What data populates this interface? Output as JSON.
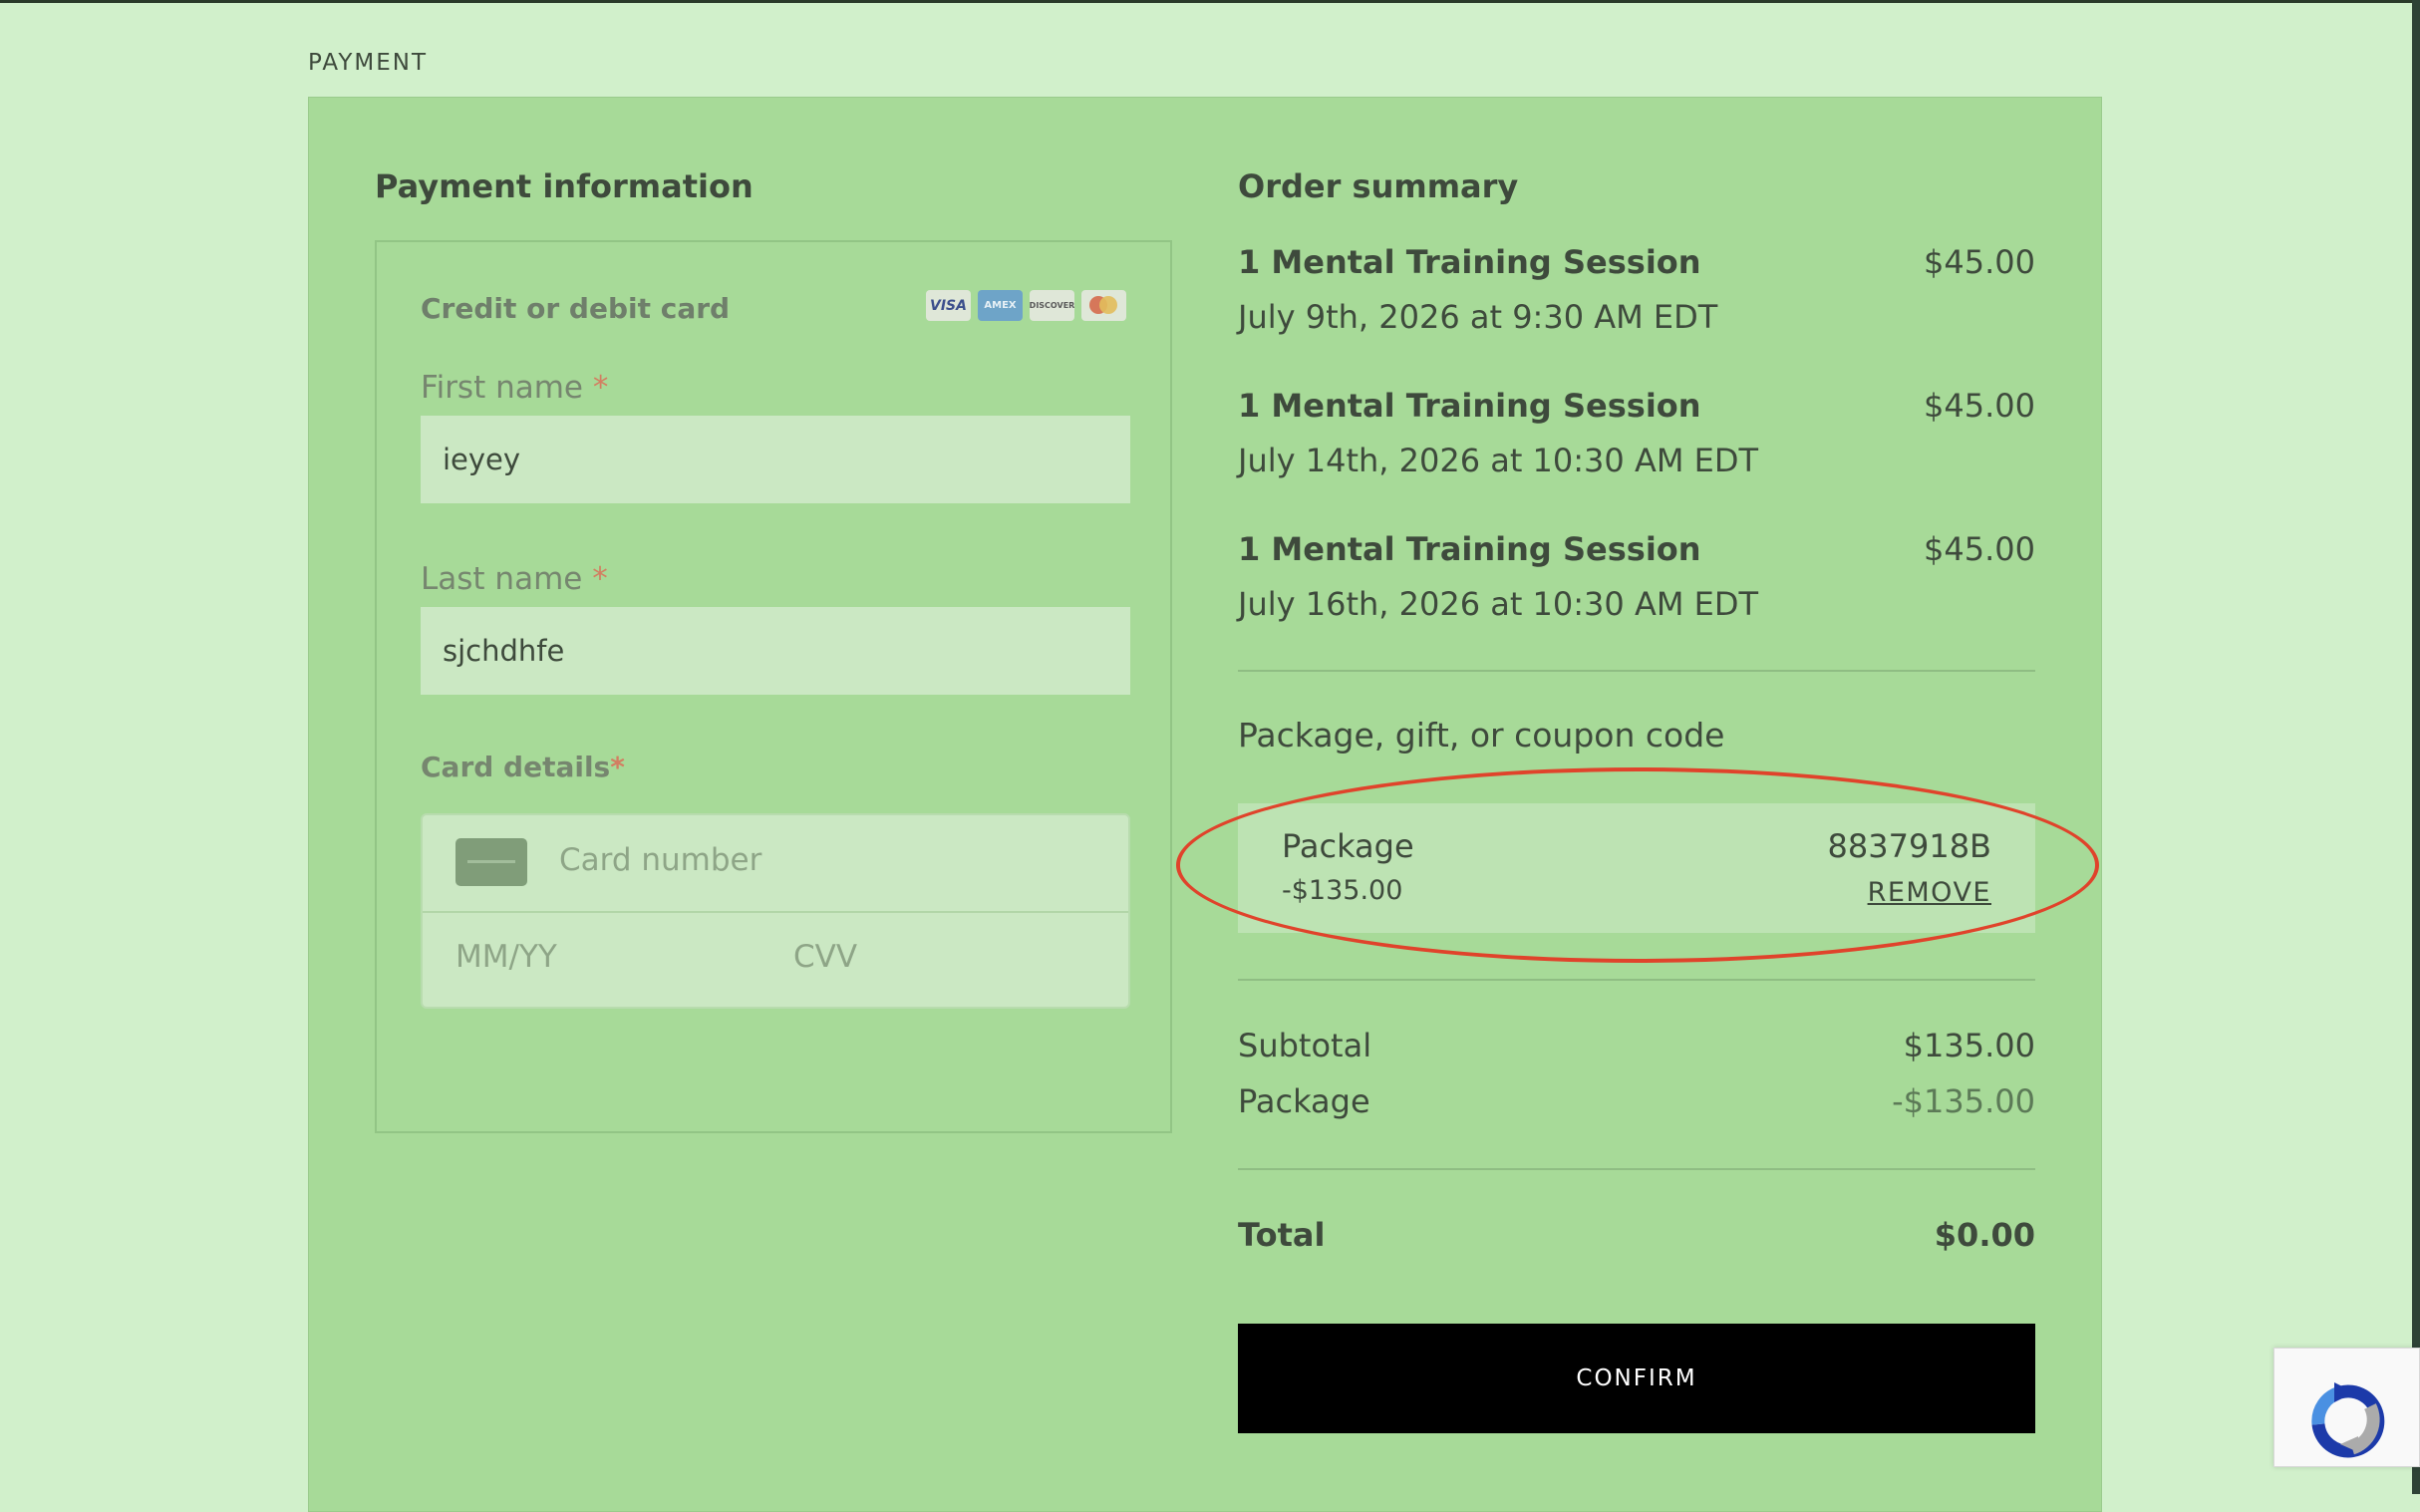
{
  "page": {
    "section_heading": "PAYMENT"
  },
  "payment": {
    "title": "Payment information",
    "card_type_label": "Credit or debit card",
    "brands": [
      "VISA",
      "AMEX",
      "DISCOVER",
      "mastercard"
    ],
    "first_name_label": "First name",
    "first_name_value": "ieyey",
    "last_name_label": "Last name",
    "last_name_value": "sjchdhfe",
    "required_mark": "*",
    "card_details_label": "Card details",
    "card_number_placeholder": "Card number",
    "expiry_placeholder": "MM/YY",
    "cvv_placeholder": "CVV"
  },
  "order": {
    "title": "Order summary",
    "items": [
      {
        "name": "1 Mental Training Session",
        "price": "$45.00",
        "date": "July 9th, 2026 at 9:30 AM EDT"
      },
      {
        "name": "1 Mental Training Session",
        "price": "$45.00",
        "date": "July 14th, 2026 at 10:30 AM EDT"
      },
      {
        "name": "1 Mental Training Session",
        "price": "$45.00",
        "date": "July 16th, 2026 at 10:30 AM EDT"
      }
    ],
    "coupon_label": "Package, gift, or coupon code",
    "package": {
      "name": "Package",
      "amount": "-$135.00",
      "code": "8837918B",
      "remove_label": "REMOVE"
    },
    "subtotal_label": "Subtotal",
    "subtotal_value": "$135.00",
    "package_label": "Package",
    "package_value": "-$135.00",
    "total_label": "Total",
    "total_value": "$0.00",
    "confirm_label": "CONFIRM"
  },
  "colors": {
    "page_bg": "#d1f0cb",
    "panel_bg": "#a7da98",
    "highlight": "#e0432b",
    "button_bg": "#000000"
  },
  "icons": [
    "credit-card-icon",
    "recaptcha-icon"
  ]
}
